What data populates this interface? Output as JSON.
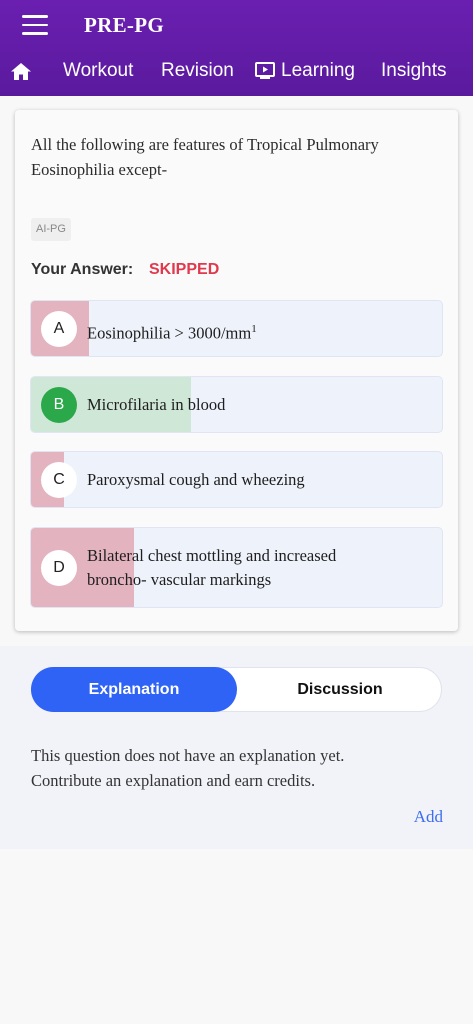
{
  "header": {
    "title": "PRE-PG",
    "nav": {
      "home_icon": "home-icon",
      "workout": "Workout",
      "revision": "Revision",
      "learning": "Learning",
      "learning_icon": "play-screen-icon",
      "insights": "Insights"
    },
    "colors": {
      "bar": "#5a1a9e"
    }
  },
  "question": {
    "text": "All the following are features of Tropical Pulmonary Eosinophilia except-",
    "tag": "AI-PG",
    "your_answer_label": "Your Answer:",
    "your_answer_value": "SKIPPED",
    "options": [
      {
        "letter": "A",
        "text": "Eosinophilia > 3000/mm",
        "sup": "1",
        "response_share": 0.14,
        "fill_color": "#e4b3c0",
        "correct": false
      },
      {
        "letter": "B",
        "text": "Microfilaria in blood",
        "response_share": 0.39,
        "fill_color": "#cfe7d6",
        "correct": true
      },
      {
        "letter": "C",
        "text": "Paroxysmal cough and wheezing",
        "response_share": 0.08,
        "fill_color": "#e4b3c0",
        "correct": false
      },
      {
        "letter": "D",
        "text_line1": "Bilateral chest mottling and increased",
        "text_line2": "broncho- vascular markings",
        "response_share": 0.25,
        "fill_color": "#e4b3c0",
        "correct": false
      }
    ]
  },
  "tabs": {
    "explanation": "Explanation",
    "discussion": "Discussion",
    "active": "explanation",
    "active_color": "#2f63f5"
  },
  "explanation": {
    "line1": "This question does not have an explanation yet.",
    "line2": "Contribute an explanation and earn credits.",
    "add_label": "Add"
  }
}
